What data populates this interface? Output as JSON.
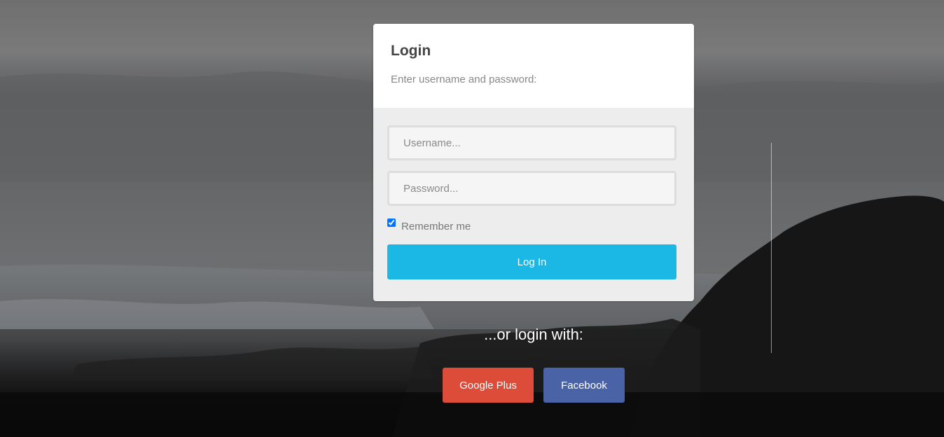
{
  "login": {
    "title": "Login",
    "subtitle": "Enter username and password:",
    "username_placeholder": "Username...",
    "password_placeholder": "Password...",
    "remember_label": "Remember me",
    "remember_checked": true,
    "submit_label": "Log In"
  },
  "social": {
    "heading": "...or login with:",
    "google_label": "Google Plus",
    "facebook_label": "Facebook"
  },
  "colors": {
    "login_button": "#1bb8e5",
    "google_button": "#dd4b39",
    "facebook_button": "#4a63a7"
  }
}
